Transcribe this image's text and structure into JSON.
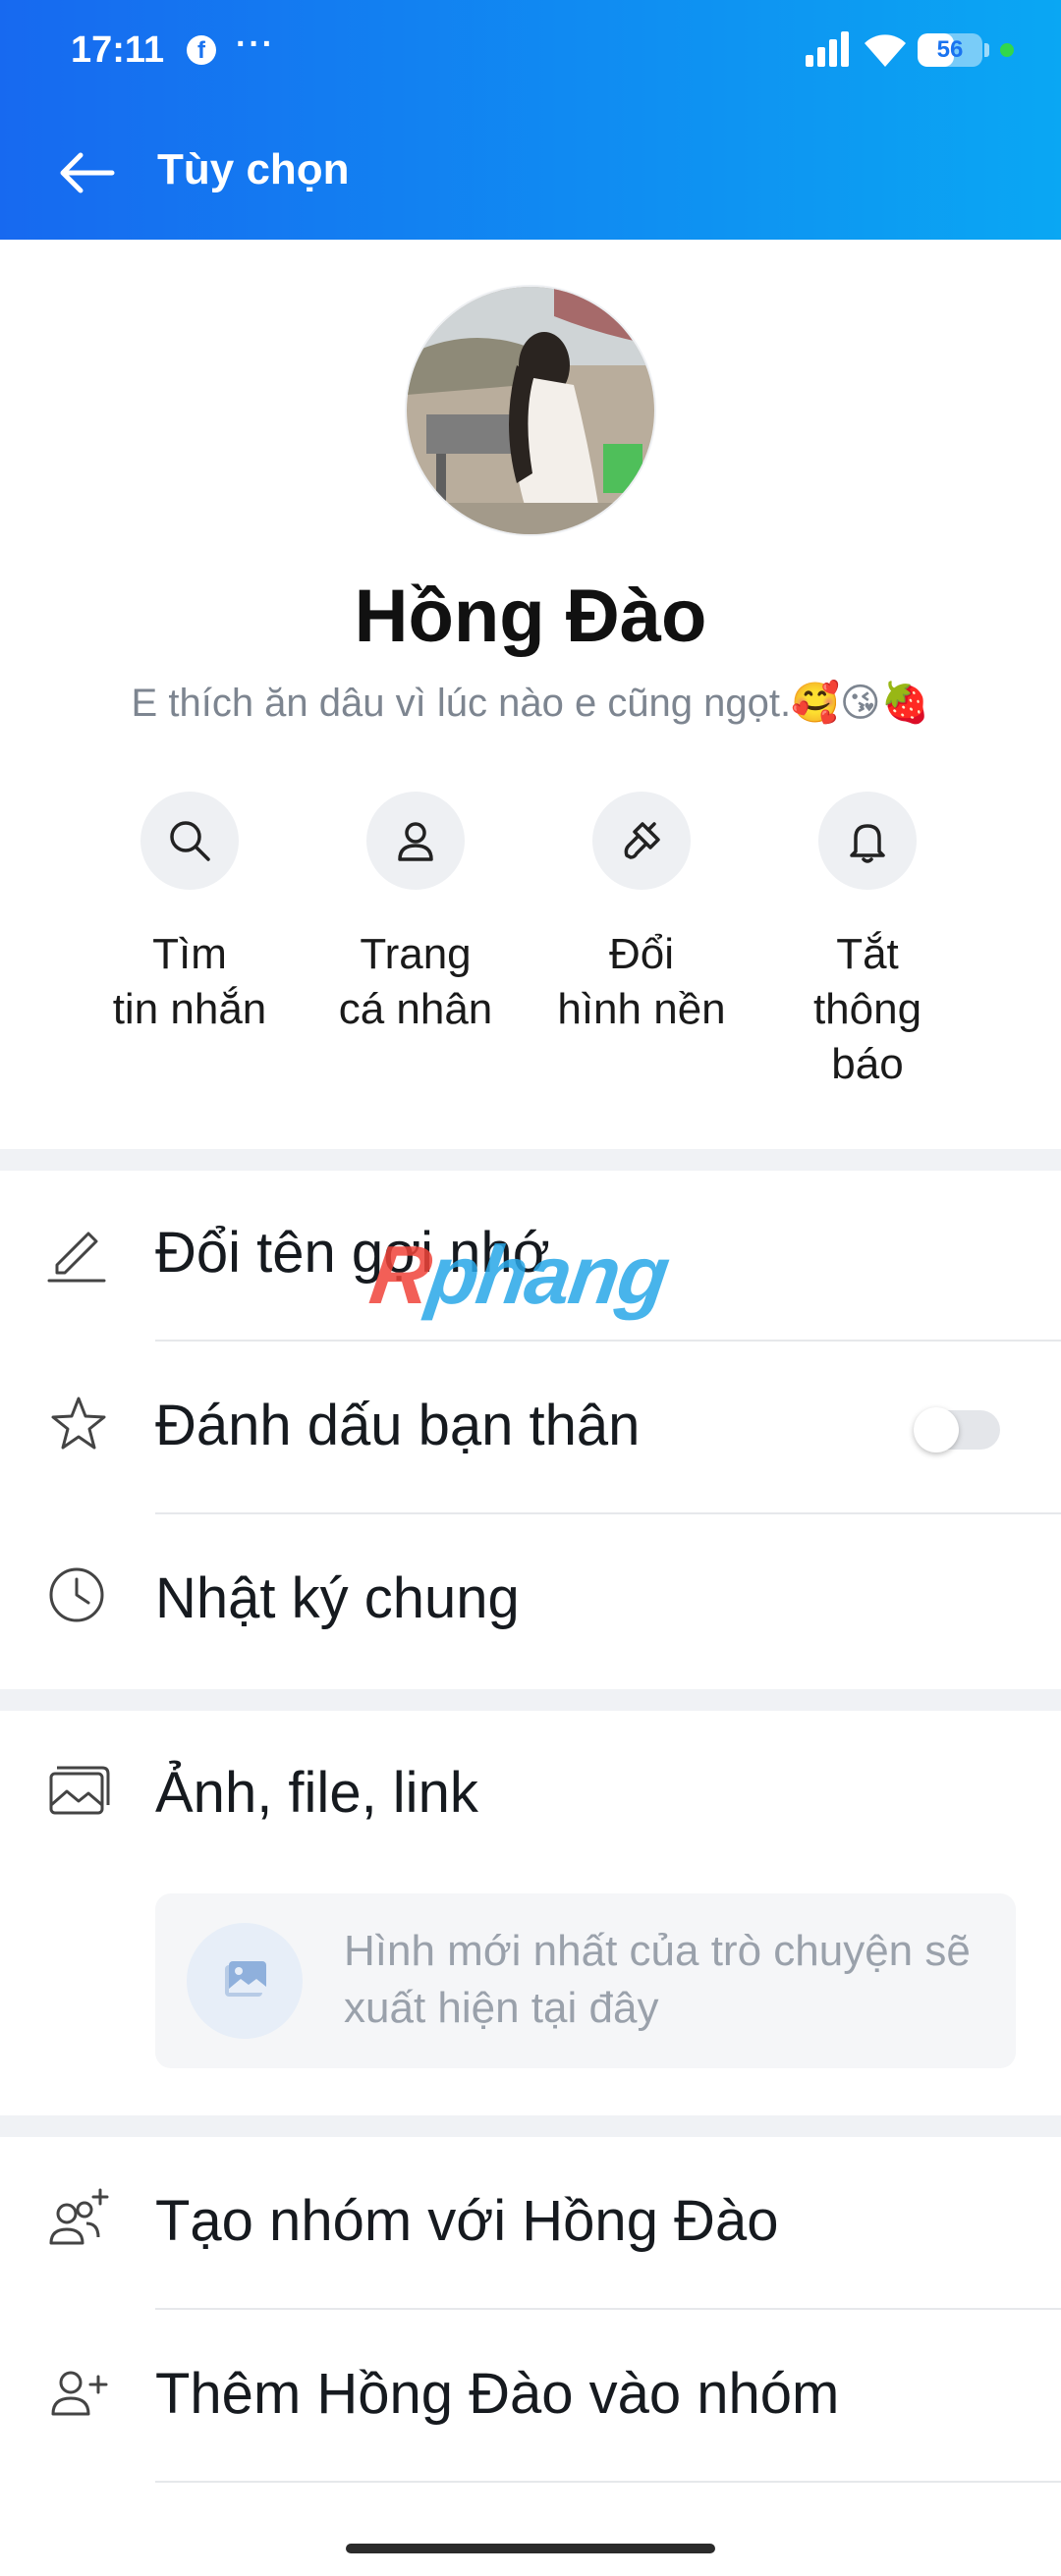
{
  "status_bar": {
    "time": "17:11",
    "dots": "···",
    "battery_level": "56",
    "battery_fraction": 0.56,
    "notification_app": "f"
  },
  "header": {
    "title": "Tùy chọn"
  },
  "profile": {
    "name": "Hồng Đào",
    "bio": "E thích ăn dâu vì lúc nào e cũng ngọt.🥰😘🍓"
  },
  "actions": [
    {
      "line1": "Tìm",
      "line2": "tin nhắn",
      "line3": "",
      "icon": "search-icon"
    },
    {
      "line1": "Trang",
      "line2": "cá nhân",
      "line3": "",
      "icon": "person-icon"
    },
    {
      "line1": "Đổi",
      "line2": "hình nền",
      "line3": "",
      "icon": "paint-brush-icon"
    },
    {
      "line1": "Tắt",
      "line2": "thông",
      "line3": "báo",
      "icon": "bell-icon"
    }
  ],
  "options": {
    "rename": "Đổi tên gợi nhớ",
    "best_friend": "Đánh dấu bạn thân",
    "best_friend_on": false,
    "shared_diary": "Nhật ký chung",
    "media": "Ảnh, file, link",
    "media_empty": "Hình mới nhất của trò chuyện sẽ xuất hiện tại đây",
    "create_group": "Tạo nhóm với Hồng Đào",
    "add_to_group": "Thêm Hồng Đào vào nhóm"
  },
  "watermark": {
    "first": "R",
    "rest": "phang"
  },
  "colors": {
    "header_start": "#1769f0",
    "header_end": "#0aa7f3"
  }
}
